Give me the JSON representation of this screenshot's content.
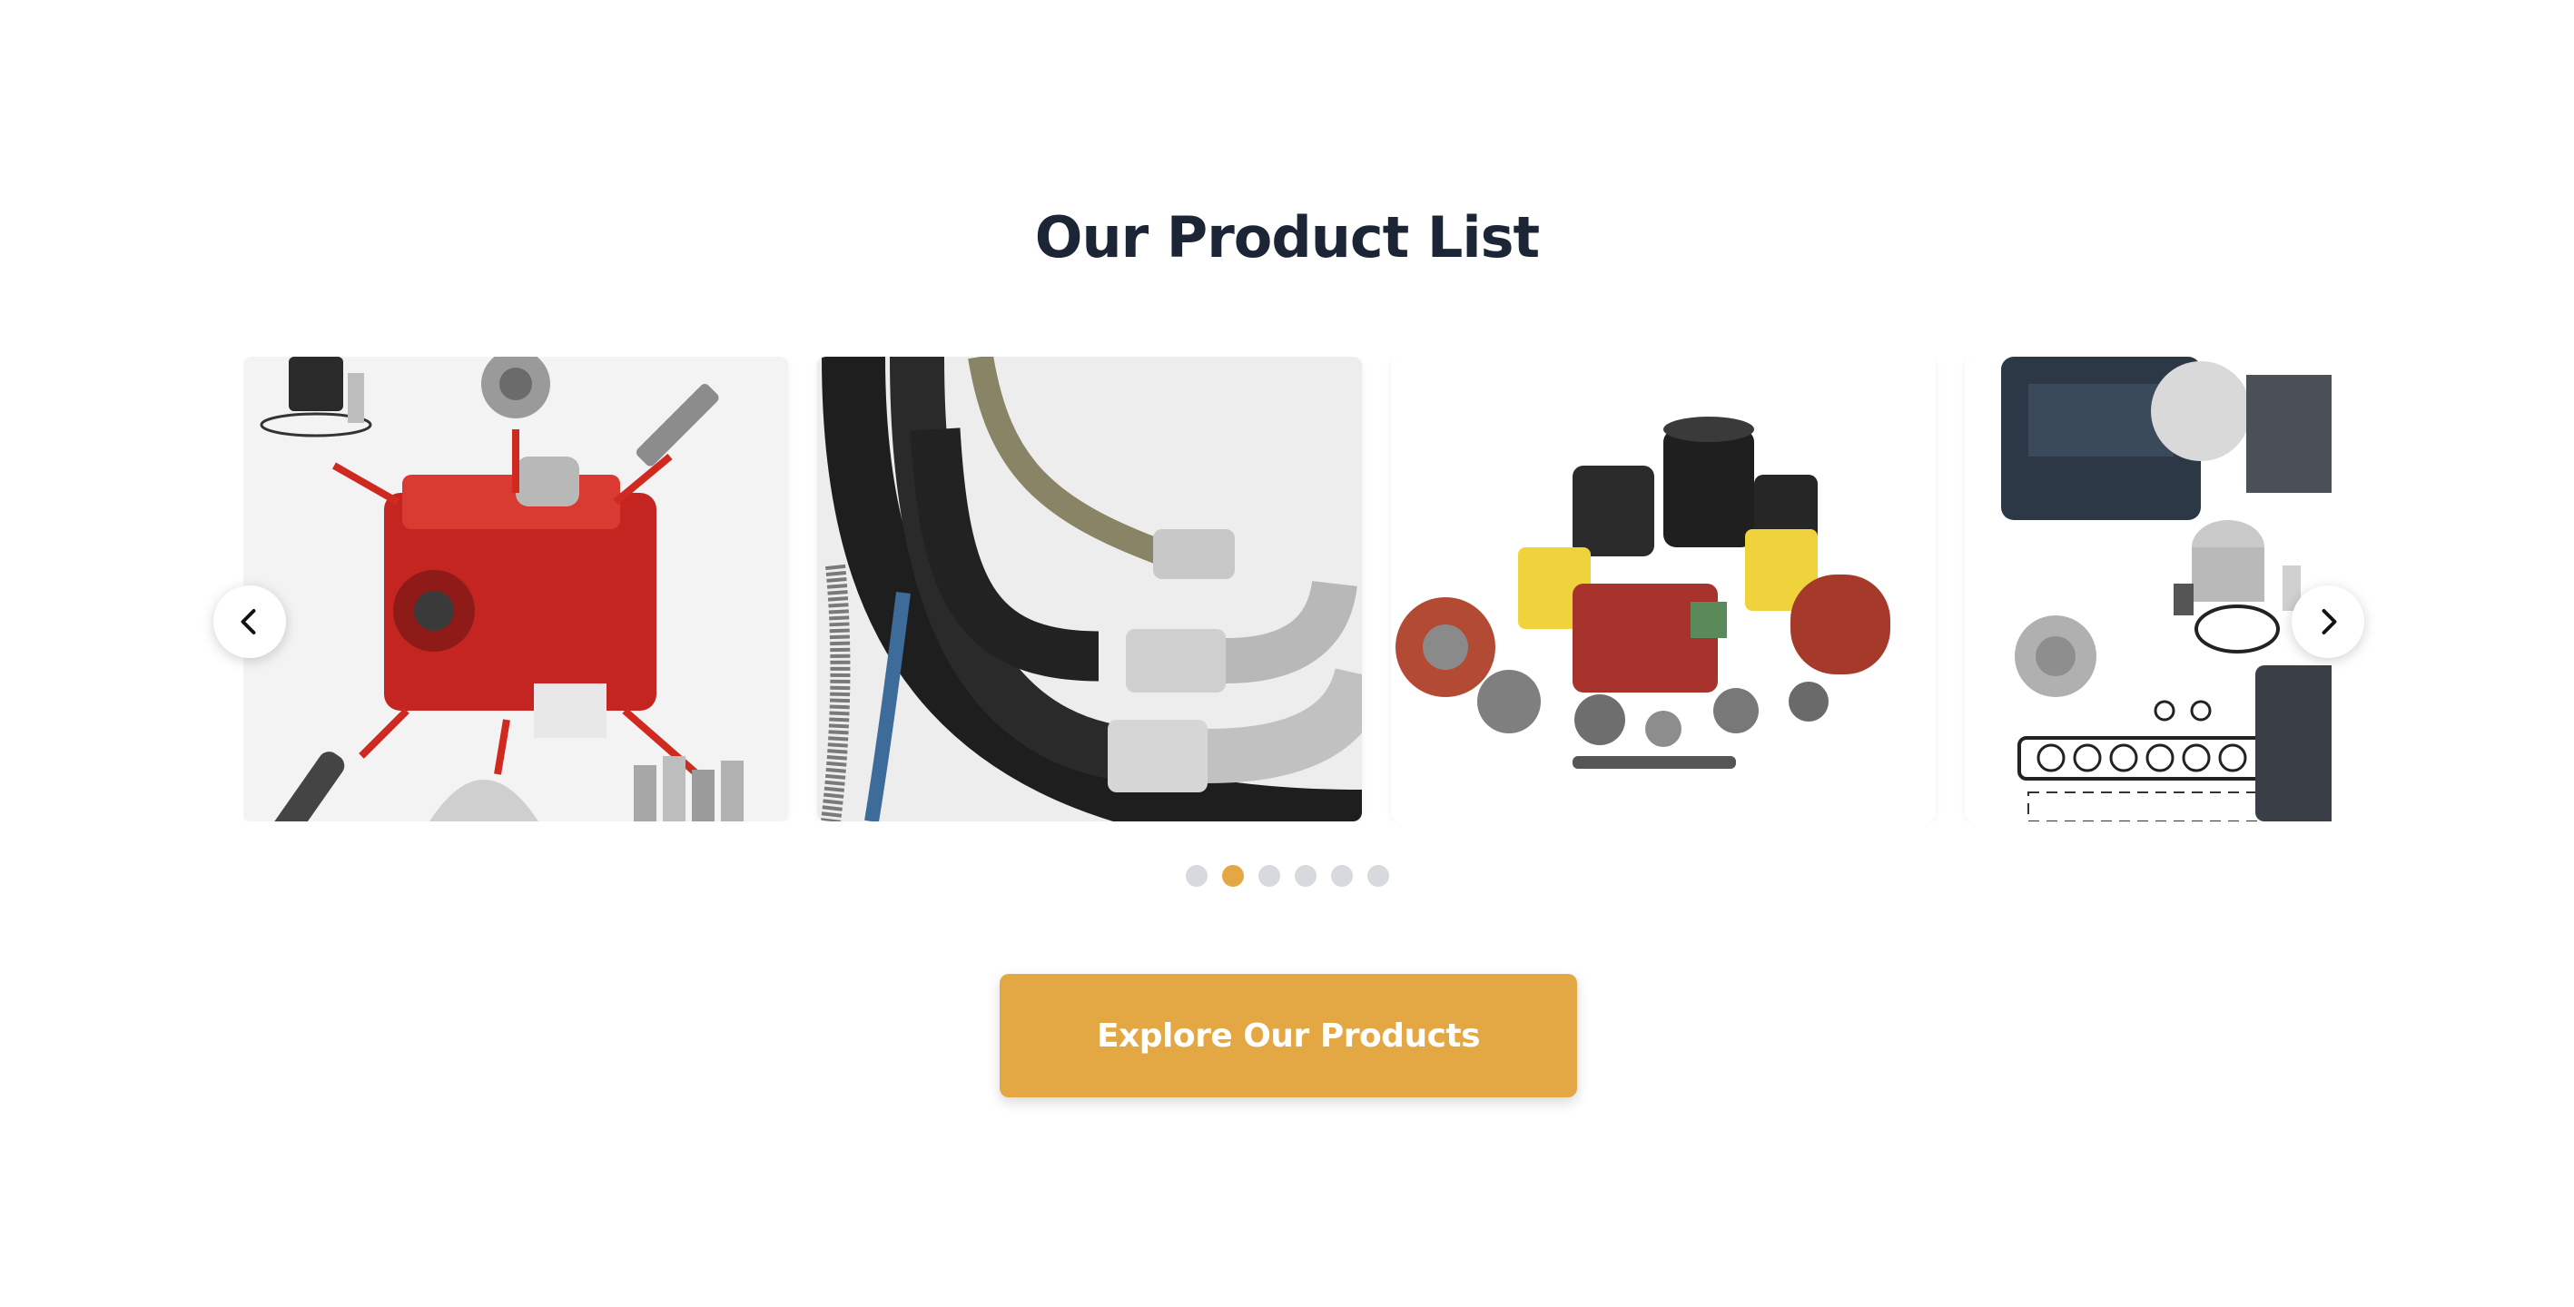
{
  "section": {
    "title": "Our Product List"
  },
  "carousel": {
    "slides": [
      {
        "icon": "engine-parts-image"
      },
      {
        "icon": "hydraulic-hoses-image"
      },
      {
        "icon": "hydraulic-pumps-image"
      },
      {
        "icon": "engine-gaskets-image"
      }
    ],
    "prev_icon": "chevron-left-icon",
    "next_icon": "chevron-right-icon",
    "dots_total": 6,
    "active_dot": 2
  },
  "cta": {
    "label": "Explore Our Products"
  },
  "colors": {
    "title": "#1c2536",
    "accent": "#e3a843",
    "dot_inactive": "#d6d9de",
    "background": "#ffffff"
  }
}
